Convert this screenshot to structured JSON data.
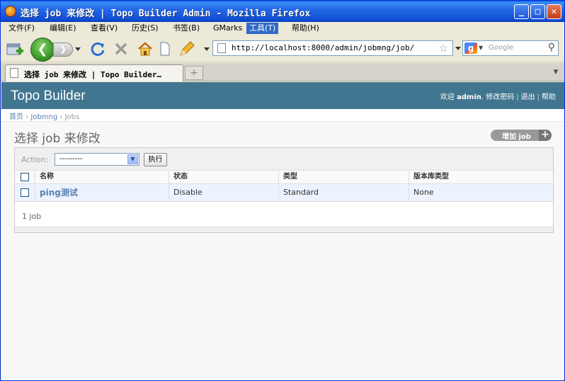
{
  "window": {
    "title": "选择 job 来修改 | Topo Builder Admin - Mozilla Firefox",
    "minimize": "_",
    "maximize": "□",
    "close": "✕"
  },
  "menu": [
    {
      "label": "文件(F)"
    },
    {
      "label": "编辑(E)"
    },
    {
      "label": "查看(V)"
    },
    {
      "label": "历史(S)"
    },
    {
      "label": "书签(B)"
    },
    {
      "label": "GMarks"
    },
    {
      "label": "工具(T)",
      "active": true
    },
    {
      "label": "帮助(H)"
    }
  ],
  "nav": {
    "url": "http://localhost:8000/admin/jobmng/job/",
    "search_placeholder": "Google",
    "search_engine_letter": "g"
  },
  "tab": {
    "title": "选择 job 来修改 | Topo Builder…",
    "new_tab": "+"
  },
  "admin": {
    "brand": "Topo Builder",
    "welcome": "欢迎",
    "username": "admin",
    "change_password": "修改密码",
    "logout": "退出",
    "help": "帮助"
  },
  "breadcrumbs": {
    "home": "首页",
    "app": "Jobmng",
    "model": "Jobs",
    "sep": "›"
  },
  "page": {
    "title": "选择 job 来修改",
    "add_label": "增加 job",
    "add_plus": "+"
  },
  "actions": {
    "label": "Action:",
    "selected": "---------",
    "go": "执行"
  },
  "table": {
    "columns": [
      "名称",
      "状态",
      "类型",
      "版本库类型"
    ],
    "rows": [
      {
        "name": "ping测试",
        "status": "Disable",
        "type": "Standard",
        "repo": "None"
      }
    ]
  },
  "paginator": {
    "count_text": "1 job"
  },
  "colors": {
    "header_bg": "#417690",
    "link": "#5b80b2",
    "row_bg": "#edf3fe",
    "menu_active": "#316ac5"
  }
}
